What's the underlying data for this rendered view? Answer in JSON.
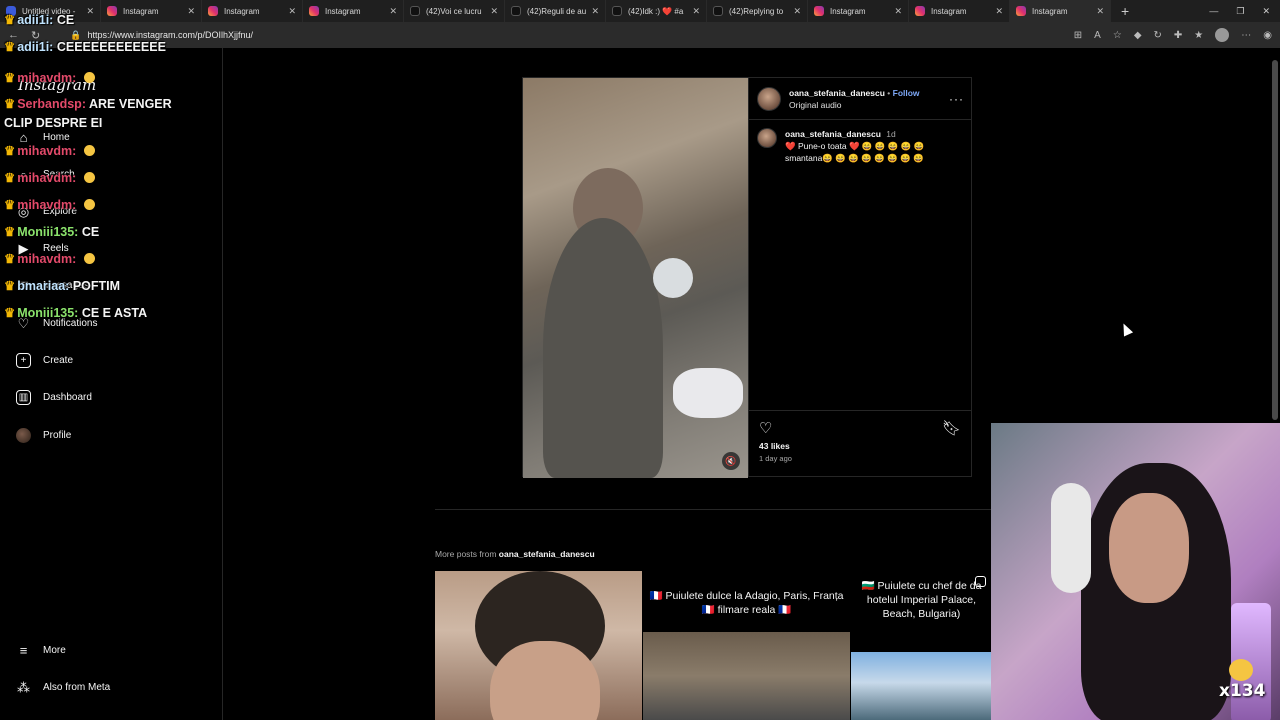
{
  "browser": {
    "tabs": [
      {
        "label": "Untitled video -",
        "icon": "yt",
        "active": false
      },
      {
        "label": "Instagram",
        "icon": "ig",
        "active": false
      },
      {
        "label": "Instagram",
        "icon": "ig",
        "active": false
      },
      {
        "label": "Instagram",
        "icon": "ig",
        "active": false
      },
      {
        "label": "(42)Voi ce lucru",
        "icon": "tt",
        "active": false
      },
      {
        "label": "(42)Reguli de au",
        "icon": "tt",
        "active": false
      },
      {
        "label": "(42)Idk :) ❤️ #a",
        "icon": "tt",
        "active": false
      },
      {
        "label": "(42)Replying to",
        "icon": "tt",
        "active": false
      },
      {
        "label": "Instagram",
        "icon": "ig",
        "active": false
      },
      {
        "label": "Instagram",
        "icon": "ig",
        "active": false
      },
      {
        "label": "Instagram",
        "icon": "ig",
        "active": true
      }
    ],
    "new_tab": "+",
    "url": "https://www.instagram.com/p/DOIlhXjjfnu/"
  },
  "sidebar": {
    "logo": "Instagram",
    "items": [
      {
        "label": "Home",
        "icon": "home-icon",
        "glyph": "⌂"
      },
      {
        "label": "Search",
        "icon": "search-icon",
        "glyph": "⌕"
      },
      {
        "label": "Explore",
        "icon": "compass-icon",
        "glyph": "◎"
      },
      {
        "label": "Reels",
        "icon": "reels-icon",
        "glyph": "▶"
      },
      {
        "label": "Messages",
        "icon": "messenger-icon",
        "glyph": "✉"
      },
      {
        "label": "Notifications",
        "icon": "heart-icon",
        "glyph": "♡"
      },
      {
        "label": "Create",
        "icon": "plus-icon",
        "glyph": "+"
      },
      {
        "label": "Dashboard",
        "icon": "dashboard-icon",
        "glyph": "▥"
      },
      {
        "label": "Profile",
        "icon": "profile-avatar-icon",
        "glyph": ""
      }
    ],
    "more": "More",
    "also_from_meta": "Also from Meta"
  },
  "chat": [
    {
      "user": "adii1i:",
      "msg": "CE",
      "color": "yellow"
    },
    {
      "user": "adii1i:",
      "msg": "CEEEEEEEEEEEE",
      "color": "yellow"
    },
    {
      "user": "mihavdm:",
      "msg": "",
      "color": "red",
      "emoji": true
    },
    {
      "user": "Serbandsp:",
      "msg": "ARE VENGER",
      "color": "red"
    },
    {
      "user": "",
      "msg": "CLIP DESPRE EI",
      "color": "white"
    },
    {
      "user": "mihavdm:",
      "msg": "",
      "color": "red",
      "emoji": true
    },
    {
      "user": "mihavdm:",
      "msg": "",
      "color": "red",
      "emoji": true
    },
    {
      "user": "mihavdm:",
      "msg": "",
      "color": "red",
      "emoji": true
    },
    {
      "user": "Moniii135:",
      "msg": "CE",
      "color": "green"
    },
    {
      "user": "mihavdm:",
      "msg": "",
      "color": "red",
      "emoji": true
    },
    {
      "user": "bmariaa:",
      "msg": "POFTIM",
      "color": "yellow"
    },
    {
      "user": "Moniii135:",
      "msg": "CE E ASTA",
      "color": "green"
    }
  ],
  "post": {
    "username": "oana_stefania_danescu",
    "follow": "Follow",
    "audio": "Original audio",
    "caption_user": "oana_stefania_danescu",
    "caption_time": "1d",
    "caption_line1": "❤️ Pune-o toata ❤️ 😄 😄 😄 😄 😄",
    "caption_line2": "smantana😄 😄 😄 😄 😄 😄 😄 😄",
    "likes": "43 likes",
    "posted": "1 day ago"
  },
  "more_posts": {
    "prefix": "More posts from",
    "username": "oana_stefania_danescu",
    "thumbs": [
      {
        "caption": ""
      },
      {
        "caption": "🇫🇷 Puiulete dulce la Adagio, Paris, Franța 🇫🇷 filmare reala 🇫🇷"
      },
      {
        "caption": "🇧🇬 Puiulete cu chef de da hotelul Imperial Palace, Beach, Bulgaria)"
      }
    ]
  },
  "webcam": {
    "overlay_text": "x134"
  }
}
